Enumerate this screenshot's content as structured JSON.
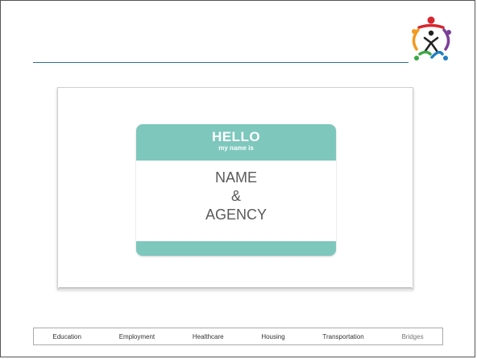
{
  "name_tag": {
    "hello": "HELLO",
    "subtitle": "my name is",
    "line1": "NAME",
    "line2": "&",
    "line3": "AGENCY"
  },
  "footer": {
    "items": [
      "Education",
      "Employment",
      "Healthcare",
      "Housing",
      "Transportation",
      "Bridges"
    ]
  },
  "colors": {
    "tag_teal": "#7ec7bd",
    "rule_blue": "#2b6ea0"
  }
}
